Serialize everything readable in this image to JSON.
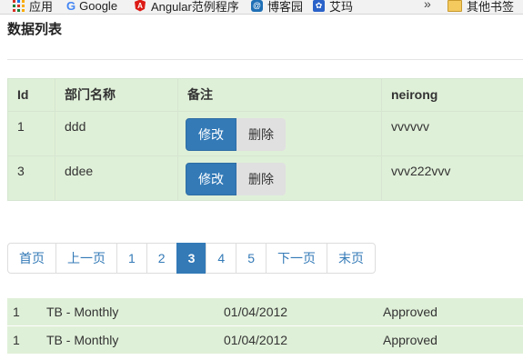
{
  "bookmarks": {
    "apps": "应用",
    "google": "Google",
    "angular": "Angular范例程序",
    "cnblogs": "博客园",
    "aima": "艾玛",
    "more": "»",
    "other": "其他书签"
  },
  "page": {
    "title": "数据列表"
  },
  "table": {
    "headers": [
      "Id",
      "部门名称",
      "备注",
      "neirong"
    ],
    "rows": [
      {
        "id": "1",
        "name": "ddd",
        "content": "vvvvvv"
      },
      {
        "id": "3",
        "name": "ddee",
        "content": "vvv222vvv"
      }
    ],
    "edit_label": "修改",
    "delete_label": "删除"
  },
  "pagination": {
    "first": "首页",
    "prev": "上一页",
    "pages": [
      "1",
      "2",
      "3",
      "4",
      "5"
    ],
    "current": "3",
    "next": "下一页",
    "last": "末页"
  },
  "plain_rows": [
    {
      "id": "1",
      "type": "TB - Monthly",
      "date": "01/04/2012",
      "status": "Approved"
    },
    {
      "id": "1",
      "type": "TB - Monthly",
      "date": "01/04/2012",
      "status": "Approved"
    }
  ],
  "colors": {
    "primary": "#337ab7",
    "row_bg": "#dff0d8"
  }
}
